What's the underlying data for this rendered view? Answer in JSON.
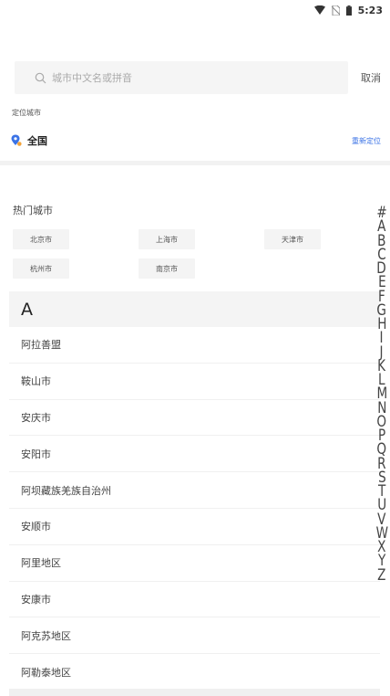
{
  "status_bar": {
    "time": "5:23",
    "icons": [
      "wifi-icon",
      "no-sim-icon",
      "battery-icon"
    ]
  },
  "search": {
    "placeholder": "城市中文名或拼音",
    "cancel_label": "取消"
  },
  "locate": {
    "title": "定位城市",
    "city": "全国",
    "relocate_label": "重新定位"
  },
  "hot": {
    "title": "热门城市",
    "cities": [
      "北京市",
      "上海市",
      "天津市",
      "杭州市",
      "南京市"
    ]
  },
  "list": {
    "letter": "A",
    "cities": [
      "阿拉善盟",
      "鞍山市",
      "安庆市",
      "安阳市",
      "阿坝藏族羌族自治州",
      "安顺市",
      "阿里地区",
      "安康市",
      "阿克苏地区",
      "阿勒泰地区"
    ]
  },
  "index": {
    "letters": [
      "#",
      "A",
      "B",
      "C",
      "D",
      "E",
      "F",
      "G",
      "H",
      "I",
      "J",
      "K",
      "L",
      "M",
      "N",
      "O",
      "P",
      "Q",
      "R",
      "S",
      "T",
      "U",
      "V",
      "W",
      "X",
      "Y",
      "Z"
    ]
  },
  "colors": {
    "accent": "#3b73e6",
    "pin_blue": "#3b73e6",
    "pin_orange": "#f2a33a",
    "background_gray": "#f4f4f4"
  }
}
